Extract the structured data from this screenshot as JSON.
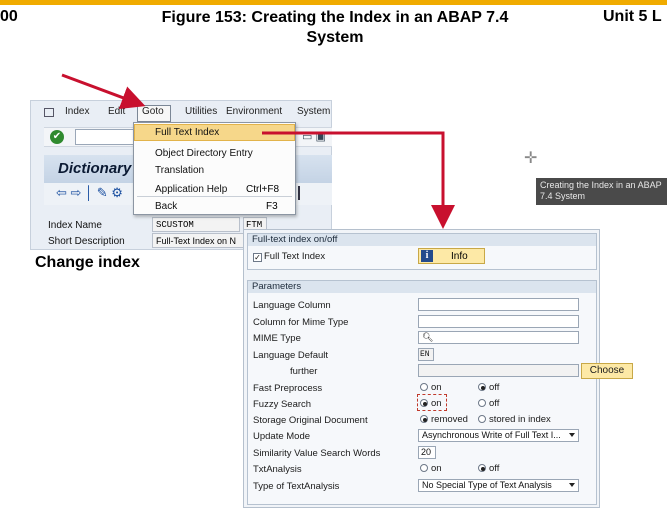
{
  "header": {
    "left": "00",
    "center": "Figure 153: Creating the Index in an ABAP 7.4 System",
    "right": "Unit 5 L"
  },
  "sap_window": {
    "menu": [
      "Index",
      "Edit",
      "Goto",
      "Utilities",
      "Environment",
      "System"
    ],
    "title": "Dictionary",
    "fields": {
      "index_name_label": "Index Name",
      "index_name_value": "SCUSTOM",
      "index_name_value2": "FTM",
      "short_desc_label": "Short Description",
      "short_desc_value": "Full-Text Index on N"
    }
  },
  "goto_menu": {
    "items": [
      {
        "label": "Full Text Index",
        "shortcut": ""
      },
      {
        "label": "Object Directory Entry",
        "shortcut": ""
      },
      {
        "label": "Translation",
        "shortcut": ""
      },
      {
        "label": "Application Help",
        "shortcut": "Ctrl+F8"
      },
      {
        "label": "Back",
        "shortcut": "F3"
      }
    ]
  },
  "caption": "Change index",
  "tooltip": "Creating the Index in an ABAP 7.4 System",
  "dialog": {
    "group1_title": "Full-text index on/off",
    "full_text_index_label": "Full Text Index",
    "full_text_index_checked": true,
    "info_button": "Info",
    "group2_title": "Parameters",
    "params": {
      "language_column": "Language Column",
      "mime_column": "Column for Mime Type",
      "mime_type": "MIME Type",
      "language_default": "Language Default",
      "language_default_value": "EN",
      "further": "further",
      "choose_button": "Choose",
      "fast_preprocess": "Fast Preprocess",
      "fuzzy_search": "Fuzzy Search",
      "storage_original": "Storage Original Document",
      "update_mode": "Update Mode",
      "update_mode_value": "Asynchronous Write of Full Text I...",
      "similarity": "Similarity Value Search Words",
      "similarity_value": "20",
      "txt_analysis": "TxtAnalysis",
      "type_text_analysis": "Type of TextAnalysis",
      "type_text_analysis_value": "No Special Type of Text Analysis"
    },
    "radio_on": "on",
    "radio_off": "off",
    "radio_removed": "removed",
    "radio_stored": "stored in index",
    "fast_preprocess_selected": "off",
    "fuzzy_search_selected": "on",
    "storage_selected": "removed",
    "txt_analysis_selected": "off"
  },
  "colors": {
    "gold": "#f0ab00",
    "arrow_red": "#c8102e",
    "highlight": "#f6d78a"
  }
}
